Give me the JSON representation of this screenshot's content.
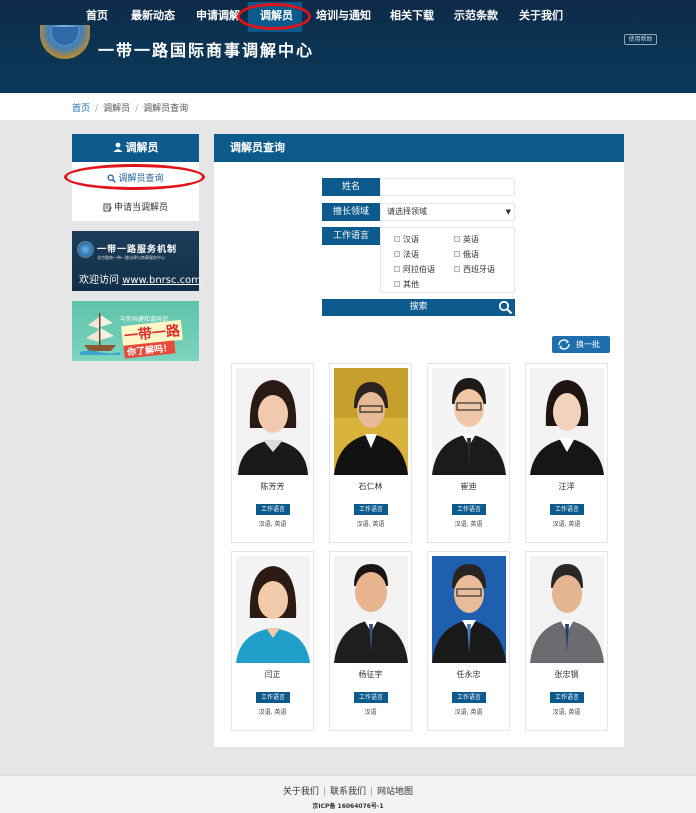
{
  "nav": {
    "items": [
      "首页",
      "最新动态",
      "申请调解",
      "调解员",
      "培训与通知",
      "相关下载",
      "示范条款",
      "关于我们"
    ],
    "active_index": 3
  },
  "header": {
    "site_title": "一带一路国际商事调解中心",
    "help_label": "使用帮助"
  },
  "breadcrumb": {
    "home": "首页",
    "level1": "调解员",
    "current": "调解员查询"
  },
  "sidebar": {
    "title": "调解员",
    "items": [
      {
        "label": "调解员查询",
        "icon": "search-icon",
        "active": true
      },
      {
        "label": "申请当调解员",
        "icon": "form-icon",
        "active": false
      }
    ],
    "banner1": {
      "title": "一带一路服务机制",
      "sub": "北京融商一带一路法律与商事服务中心",
      "visit": "欢迎访问",
      "url": "www.bnrsc.com"
    },
    "banner2": {
      "top": "与你共建和谐共识",
      "big": "一带一路",
      "small": "你了解吗！"
    }
  },
  "main": {
    "title": "调解员查询",
    "form": {
      "name_label": "姓名",
      "name_value": "",
      "field_label": "擅长领域",
      "field_value": "请选择领域",
      "lang_label": "工作语言",
      "languages": [
        "汉语",
        "英语",
        "法语",
        "俄语",
        "阿拉伯语",
        "西班牙语",
        "其他"
      ],
      "search_label": "搜索"
    },
    "refresh_label": "换一批",
    "tag_label": "工作语言",
    "mediators": [
      {
        "name": "陈芳芳",
        "langs": "汉语, 英语"
      },
      {
        "name": "石仁林",
        "langs": "汉语, 英语"
      },
      {
        "name": "崔迪",
        "langs": "汉语, 英语"
      },
      {
        "name": "汪洋",
        "langs": "汉语, 英语"
      },
      {
        "name": "闫正",
        "langs": "汉语, 英语"
      },
      {
        "name": "杨征宇",
        "langs": "汉语"
      },
      {
        "name": "任永忠",
        "langs": "汉语, 英语"
      },
      {
        "name": "张忠钢",
        "langs": "汉语, 英语"
      }
    ]
  },
  "footer": {
    "links": [
      "关于我们",
      "联系我们",
      "网站地图"
    ],
    "icp": "京ICP备 16064076号-1"
  },
  "colors": {
    "header_bg": "#0c3352",
    "accent_blue": "#0d5a8c",
    "link_blue": "#1d6fb0",
    "annotation_red": "#e0141b",
    "page_bg": "#e6e6e6"
  }
}
